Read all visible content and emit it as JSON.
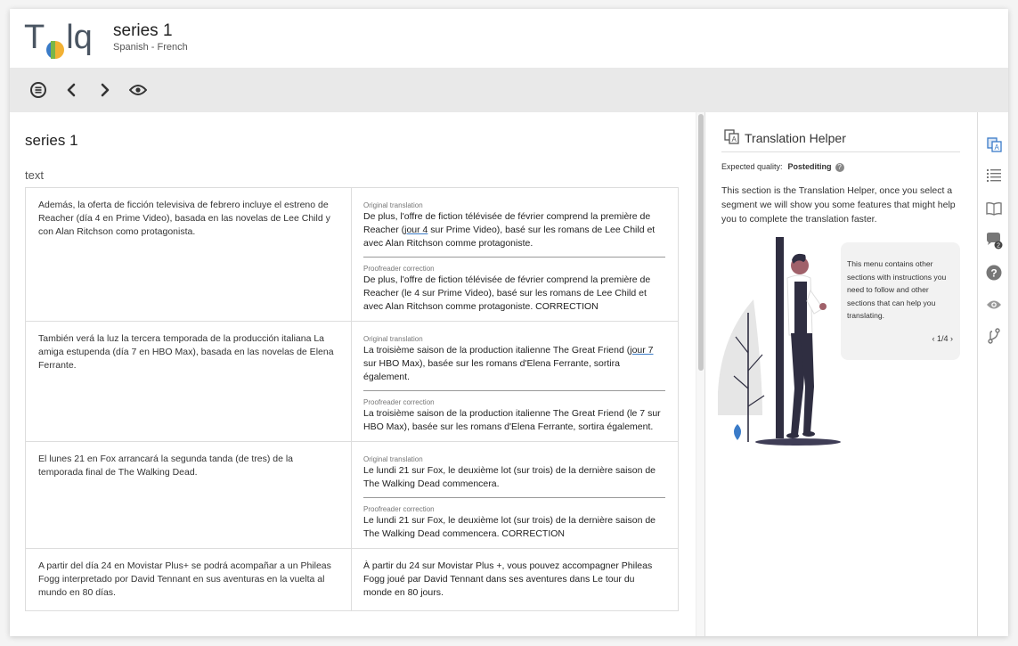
{
  "app": {
    "logo_text_left": "T",
    "logo_text_right": "lq",
    "project_title": "series 1",
    "language_pair": "Spanish - French"
  },
  "toolbar": {
    "icons": [
      "list-circle-icon",
      "chevron-left-icon",
      "chevron-right-icon",
      "eye-icon"
    ]
  },
  "document": {
    "title": "series 1",
    "section_label": "text",
    "original_label": "Original translation",
    "proofreader_label": "Proofreader correction",
    "rows": [
      {
        "source": "Además, la oferta de ficción televisiva de febrero incluye el estreno de Reacher (día 4 en Prime Video), basada en las novelas de Lee Child y con Alan Ritchson como protagonista.",
        "original_pre": "De plus, l'offre de fiction télévisée de février comprend la première de Reacher (",
        "original_u": "jour 4",
        "original_post": " sur Prime Video), basé sur les romans de Lee Child et avec Alan Ritchson comme protagoniste.",
        "correction": "De plus, l'offre de fiction télévisée de février comprend la première de Reacher (le 4 sur Prime Video), basé sur les romans de Lee Child et avec Alan Ritchson comme protagoniste. CORRECTION"
      },
      {
        "source": "También verá la luz la tercera temporada de la producción italiana La amiga estupenda (día 7 en HBO Max), basada en las novelas de Elena Ferrante.",
        "original_pre": "La troisième saison de la production italienne The Great Friend (",
        "original_u": "jour 7",
        "original_post": " sur HBO Max), basée sur les romans d'Elena Ferrante, sortira également.",
        "correction": "La troisième saison de la production italienne The Great Friend (le 7 sur HBO Max), basée sur les romans d'Elena Ferrante, sortira également."
      },
      {
        "source": "El lunes 21 en Fox arrancará la segunda tanda (de tres) de la temporada final de The Walking Dead.",
        "original_pre": "Le lundi 21 sur Fox, le deuxième lot (sur trois) de la dernière saison de The Walking Dead commencera.",
        "original_u": "",
        "original_post": "",
        "correction": "Le lundi 21 sur Fox, le deuxième lot (sur trois) de la dernière saison de The Walking Dead commencera. CORRECTION"
      },
      {
        "source": "A partir del día 24 en Movistar Plus+ se podrá acompañar a un Phileas Fogg interpretado por David Tennant en sus aventuras en la vuelta al mundo en 80 días.",
        "target": "À partir du 24 sur Movistar Plus +, vous pouvez accompagner Phileas Fogg joué par David Tennant dans ses aventures dans Le tour du monde en 80 jours."
      }
    ]
  },
  "helper": {
    "title": "Translation Helper",
    "expected_quality_label": "Expected quality:",
    "expected_quality_value": "Postediting",
    "description": "This section is the Translation Helper, once you select a segment we will show you some features that might help you to complete the translation faster.",
    "tip": "This menu contains other sections with instructions you need to follow and other sections that can help you translating.",
    "tip_pager": "1/4",
    "colors": {
      "accent": "#3a7bc8",
      "figure_dark": "#2f2e41",
      "shirt": "#ffffff",
      "tree": "#e6e6e6",
      "leaf_blue": "#3a7bc8"
    }
  },
  "rail": {
    "icons": [
      "translation-helper-icon",
      "list-icon",
      "book-icon",
      "comments-icon",
      "help-icon",
      "eye-icon",
      "branch-icon"
    ],
    "comments_badge": "2"
  }
}
